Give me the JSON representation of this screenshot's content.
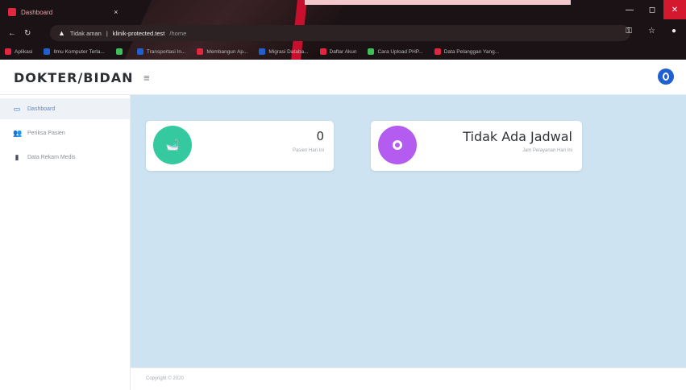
{
  "browser": {
    "tab_title": "Dashboard",
    "tab_close": "×",
    "address": {
      "status": "Tidak aman",
      "separator": "|",
      "url": "klinik-protected.test",
      "path": "/home"
    },
    "controls": {
      "minimize": "—",
      "maximize": "◻",
      "close": "✕"
    },
    "bookmarks": [
      {
        "label": "Aplikasi",
        "color": "#e2263f"
      },
      {
        "label": "Ilmu Komputer Terla...",
        "color": "#1f5fd0"
      },
      {
        "label": "",
        "color": "#3fbf5c"
      },
      {
        "label": "Transportasi In...",
        "color": "#1f5fd0"
      },
      {
        "label": "Membangun Ap...",
        "color": "#e2263f"
      },
      {
        "label": "Migrasi Databa...",
        "color": "#1f5fd0"
      },
      {
        "label": "Daftar Akun",
        "color": "#e2263f"
      },
      {
        "label": "Cara Upload PHP...",
        "color": "#3fbf5c"
      },
      {
        "label": "Data Pelanggan Yang...",
        "color": "#e2263f"
      }
    ]
  },
  "header": {
    "brand": "DOKTER/BIDAN",
    "menu_toggle": "≡"
  },
  "sidebar": {
    "items": [
      {
        "label": "Dashboard",
        "icon": "monitor-icon",
        "glyph": "▭"
      },
      {
        "label": "Periksa Pasien",
        "icon": "users-icon",
        "glyph": "👥"
      },
      {
        "label": "Data Rekam Medis",
        "icon": "file-icon",
        "glyph": "▮"
      }
    ]
  },
  "cards": [
    {
      "value": "0",
      "subtitle": "Pasien Hari Ini",
      "color": "#35c9a0",
      "icon": "bath-icon"
    },
    {
      "value": "Tidak Ada Jadwal",
      "subtitle": "Jam Pelayanan Hari Ini",
      "color": "#b45cf0",
      "icon": "disc-icon"
    }
  ],
  "footer": {
    "text": "Copyright © 2020"
  }
}
